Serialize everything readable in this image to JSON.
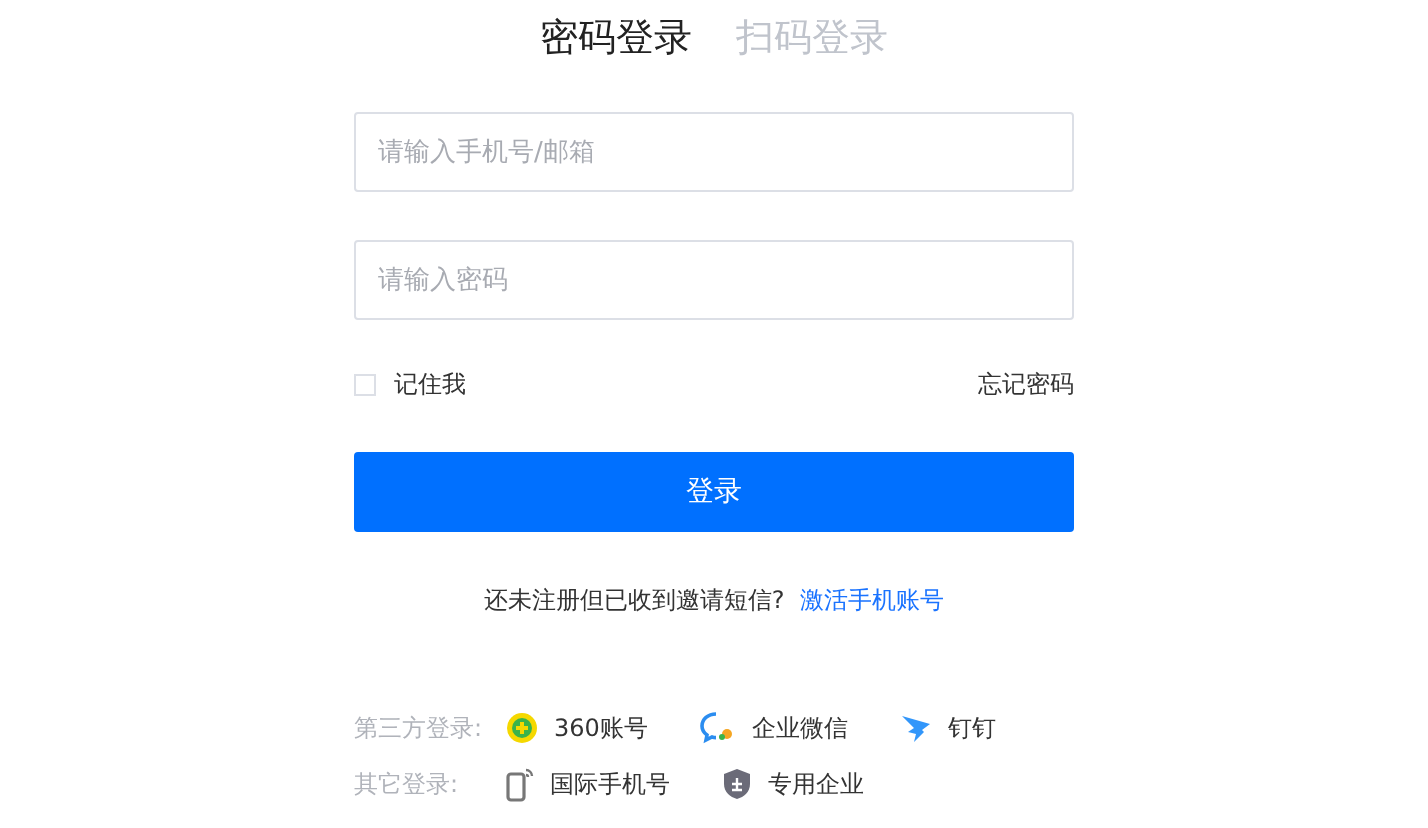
{
  "tabs": [
    {
      "label": "密码登录",
      "selected": true
    },
    {
      "label": "扫码登录",
      "selected": false
    }
  ],
  "account_field": {
    "placeholder": "请输入手机号/邮箱"
  },
  "password_field": {
    "placeholder": "请输入密码"
  },
  "remember_me": {
    "label": "记住我",
    "checked": false
  },
  "forgot_password": "忘记密码",
  "login_button": "登录",
  "invite": {
    "text": "还未注册但已收到邀请短信?",
    "link": "激活手机账号"
  },
  "other_logins": [
    {
      "label": "第三方登录:",
      "options": [
        {
          "kind": "circle",
          "label": "360账号"
        },
        {
          "kind": "bubble",
          "label": "企业微信"
        },
        {
          "kind": "wing",
          "label": "钉钉"
        }
      ]
    },
    {
      "label": "其它登录:",
      "options": [
        {
          "kind": "phone",
          "label": "国际手机号"
        },
        {
          "kind": "shield",
          "label": "专用企业"
        }
      ]
    }
  ]
}
